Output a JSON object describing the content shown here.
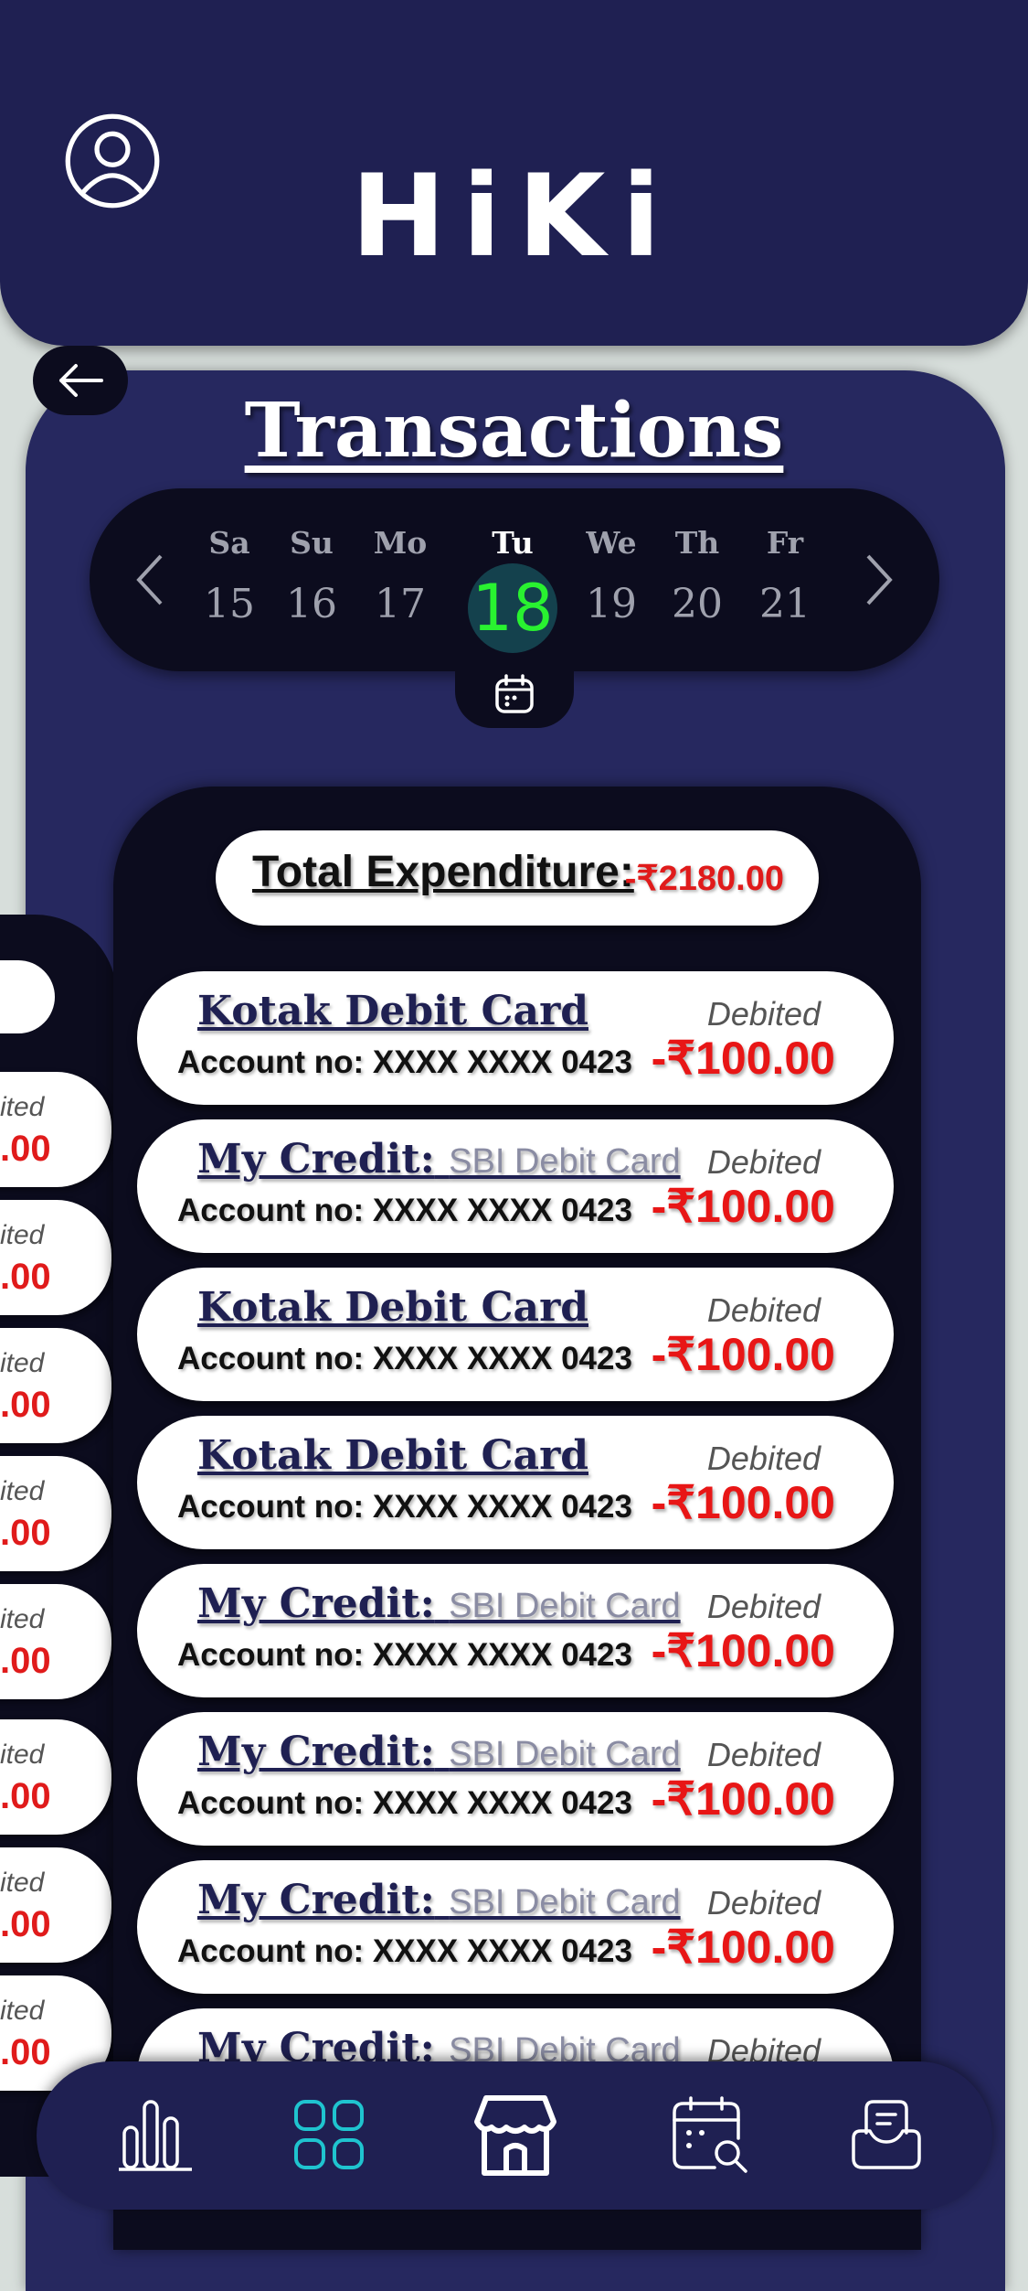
{
  "app": {
    "title": "HiKi"
  },
  "page": {
    "title": "Transactions"
  },
  "calendar": {
    "days": [
      {
        "name": "Sa",
        "num": "15"
      },
      {
        "name": "Su",
        "num": "16"
      },
      {
        "name": "Mo",
        "num": "17"
      },
      {
        "name": "Tu",
        "num": "18"
      },
      {
        "name": "We",
        "num": "19"
      },
      {
        "name": "Th",
        "num": "20"
      },
      {
        "name": "Fr",
        "num": "21"
      }
    ],
    "selected": "18",
    "selected_color": "#29f230"
  },
  "summary": {
    "label": "Total Expenditure:",
    "amount": "-₹2180.00"
  },
  "transactions": [
    {
      "title": "Kotak Debit Card",
      "subtitle": "",
      "account": "Account no: XXXX XXXX 0423",
      "status": "Debited",
      "amount": "-₹100.00"
    },
    {
      "title": "My Credit:",
      "subtitle": "SBI Debit Card",
      "account": "Account no: XXXX XXXX 0423",
      "status": "Debited",
      "amount": "-₹100.00"
    },
    {
      "title": "Kotak Debit Card",
      "subtitle": "",
      "account": "Account no: XXXX XXXX 0423",
      "status": "Debited",
      "amount": "-₹100.00"
    },
    {
      "title": "Kotak Debit Card",
      "subtitle": "",
      "account": "Account no: XXXX XXXX 0423",
      "status": "Debited",
      "amount": "-₹100.00"
    },
    {
      "title": "My Credit:",
      "subtitle": "SBI Debit Card",
      "account": "Account no: XXXX XXXX 0423",
      "status": "Debited",
      "amount": "-₹100.00"
    },
    {
      "title": "My Credit:",
      "subtitle": "SBI Debit Card",
      "account": "Account no: XXXX XXXX 0423",
      "status": "Debited",
      "amount": "-₹100.00"
    },
    {
      "title": "My Credit:",
      "subtitle": "SBI Debit Card",
      "account": "Account no: XXXX XXXX 0423",
      "status": "Debited",
      "amount": "-₹100.00"
    },
    {
      "title": "My Credit:",
      "subtitle": "SBI Debit Card",
      "account": "",
      "status": "Debited",
      "amount": ""
    }
  ],
  "side_list": [
    {
      "status": "ited",
      "amount": ".00"
    },
    {
      "status": "ited",
      "amount": ".00"
    },
    {
      "status": "ited",
      "amount": ".00"
    },
    {
      "status": "ited",
      "amount": ".00"
    },
    {
      "status": "ited",
      "amount": ".00"
    },
    {
      "status": "ited",
      "amount": ".00"
    },
    {
      "status": "ited",
      "amount": ".00"
    },
    {
      "status": "ited",
      "amount": ".00"
    }
  ],
  "nav": {
    "items": [
      "bar-chart-icon",
      "grid-icon",
      "store-icon",
      "calendar-search-icon",
      "inbox-icon"
    ],
    "active": "grid-icon",
    "active_color": "#1fc4cf"
  },
  "colors": {
    "header": "#1f2052",
    "panel": "#26285f",
    "dark": "#0c0c1e",
    "debit_red": "#e81616"
  }
}
